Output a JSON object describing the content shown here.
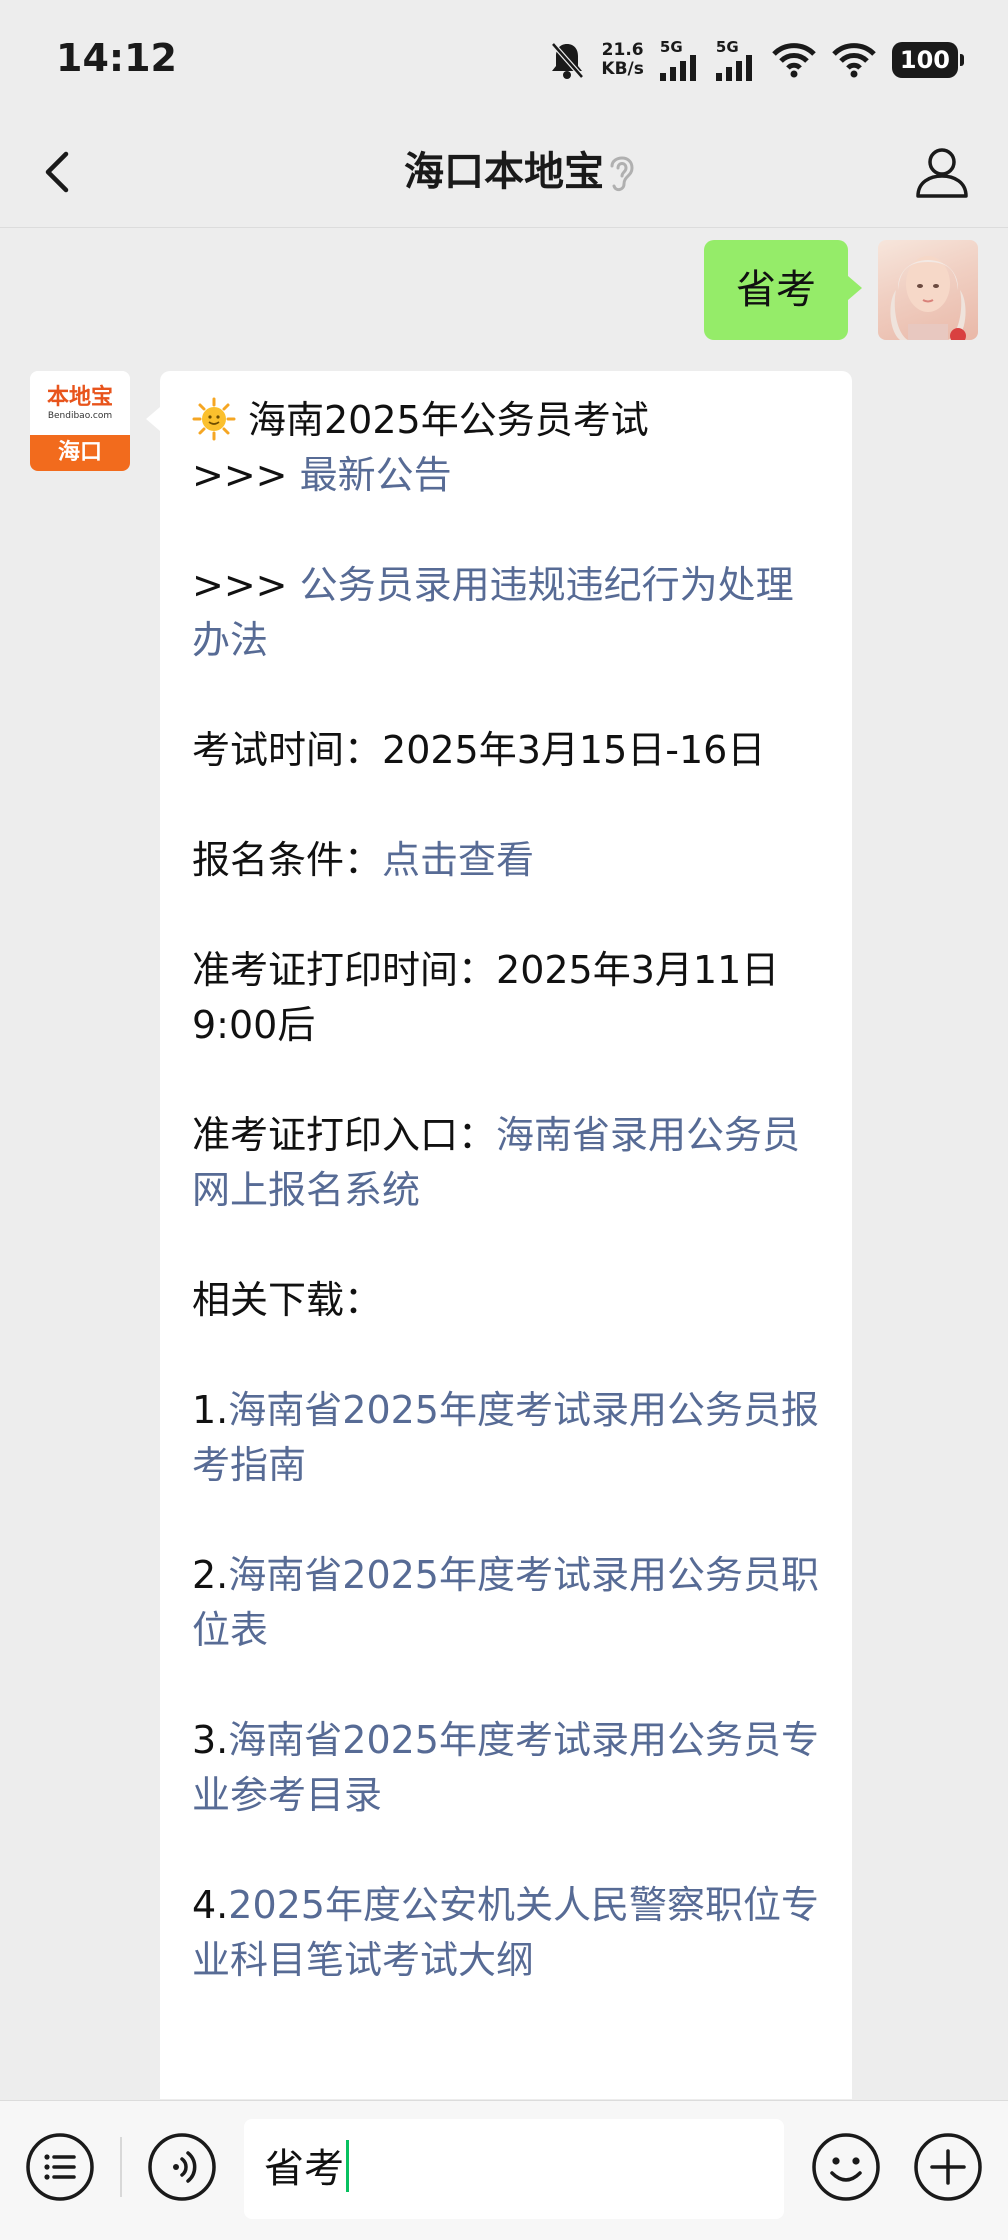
{
  "status_bar": {
    "time": "14:12",
    "speed_value": "21.6",
    "speed_unit": "KB/s",
    "sim1_tag": "5G",
    "sim2_tag": "5G",
    "battery": "100"
  },
  "nav": {
    "title": "海口本地宝"
  },
  "chat": {
    "outgoing": {
      "text": "省考"
    },
    "bot_avatar": {
      "brand": "本地宝",
      "sub": "Bendibao.com",
      "city": "海口"
    },
    "incoming": {
      "headline": "海南2025年公务员考试",
      "lines": [
        {
          "prefix": ">>> ",
          "link": "最新公告"
        },
        {
          "prefix": ">>> ",
          "link": "公务员录用违规违纪行为处理办法"
        },
        {
          "label": "考试时间：",
          "value": "2025年3月15日-16日"
        },
        {
          "label": "报名条件：",
          "link": "点击查看"
        },
        {
          "label": "准考证打印时间：",
          "value": "2025年3月11日9:00后"
        },
        {
          "label": "准考证打印入口：",
          "link": "海南省录用公务员网上报名系统"
        },
        {
          "label": "相关下载："
        },
        {
          "prefix": "1.",
          "link": "海南省2025年度考试录用公务员报考指南"
        },
        {
          "prefix": "2.",
          "link": "海南省2025年度考试录用公务员职位表"
        },
        {
          "prefix": "3.",
          "link": "海南省2025年度考试录用公务员专业参考目录"
        },
        {
          "prefix": "4.",
          "link": "2025年度公安机关人民警察职位专业科目笔试考试大纲"
        }
      ]
    }
  },
  "input_bar": {
    "value": "省考"
  },
  "colors": {
    "background": "#ededed",
    "bubble_out": "#95ec69",
    "bubble_in": "#ffffff",
    "link": "#576b95",
    "caret": "#07c160",
    "brand_orange": "#f26b1d"
  },
  "icons": [
    "bell-off-icon",
    "signal-icon",
    "wifi-icon",
    "battery-icon",
    "back-icon",
    "ear-icon",
    "profile-icon",
    "sun-emoji-icon",
    "menu-list-icon",
    "voice-icon",
    "emoji-icon",
    "plus-icon"
  ]
}
